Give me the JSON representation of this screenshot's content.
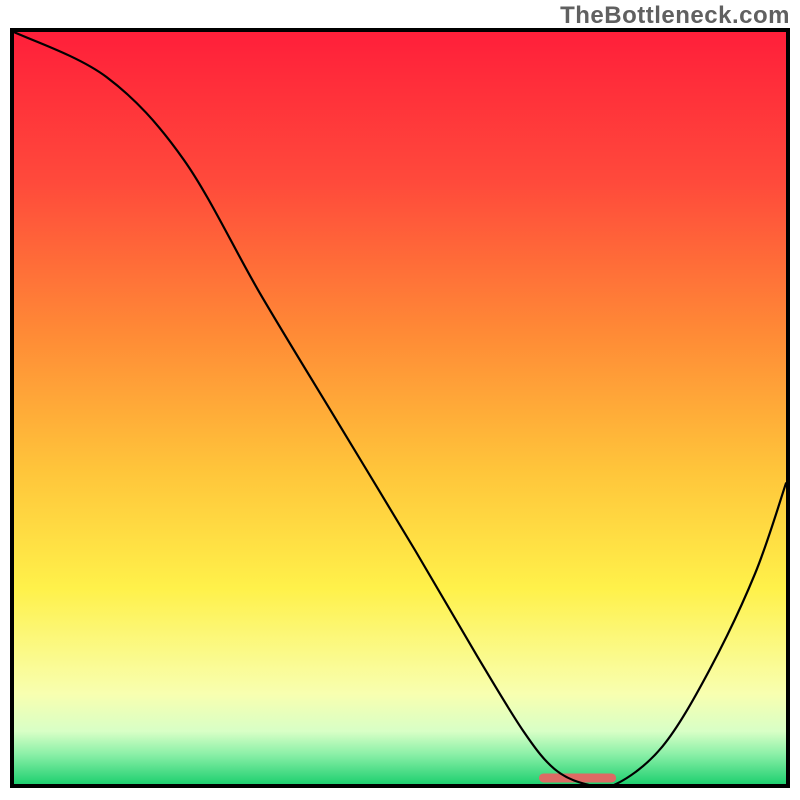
{
  "watermark": "TheBottleneck.com",
  "chart_data": {
    "type": "line",
    "title": "",
    "xlabel": "",
    "ylabel": "",
    "xlim": [
      0,
      100
    ],
    "ylim": [
      0,
      100
    ],
    "grid": false,
    "background_gradient": {
      "stops": [
        {
          "pos": 0.0,
          "color": "#ff1f3a"
        },
        {
          "pos": 0.2,
          "color": "#ff4a3b"
        },
        {
          "pos": 0.4,
          "color": "#ff8a36"
        },
        {
          "pos": 0.58,
          "color": "#ffc43a"
        },
        {
          "pos": 0.74,
          "color": "#fff14a"
        },
        {
          "pos": 0.88,
          "color": "#f8ffb0"
        },
        {
          "pos": 0.93,
          "color": "#d8ffc6"
        },
        {
          "pos": 0.96,
          "color": "#8cf0a8"
        },
        {
          "pos": 1.0,
          "color": "#1fd070"
        }
      ]
    },
    "series": [
      {
        "name": "curve",
        "color": "#000000",
        "width": 2.2,
        "x": [
          0,
          12,
          22,
          32,
          42,
          52,
          60,
          66,
          70,
          74,
          78,
          84,
          90,
          96,
          100
        ],
        "values": [
          100,
          94,
          83,
          65,
          48,
          31,
          17,
          7,
          2,
          0,
          0,
          5,
          15,
          28,
          40
        ]
      }
    ],
    "marker": {
      "name": "trough-marker",
      "color": "#dd6a64",
      "x_start": 68,
      "x_end": 78,
      "thickness": 12
    }
  }
}
